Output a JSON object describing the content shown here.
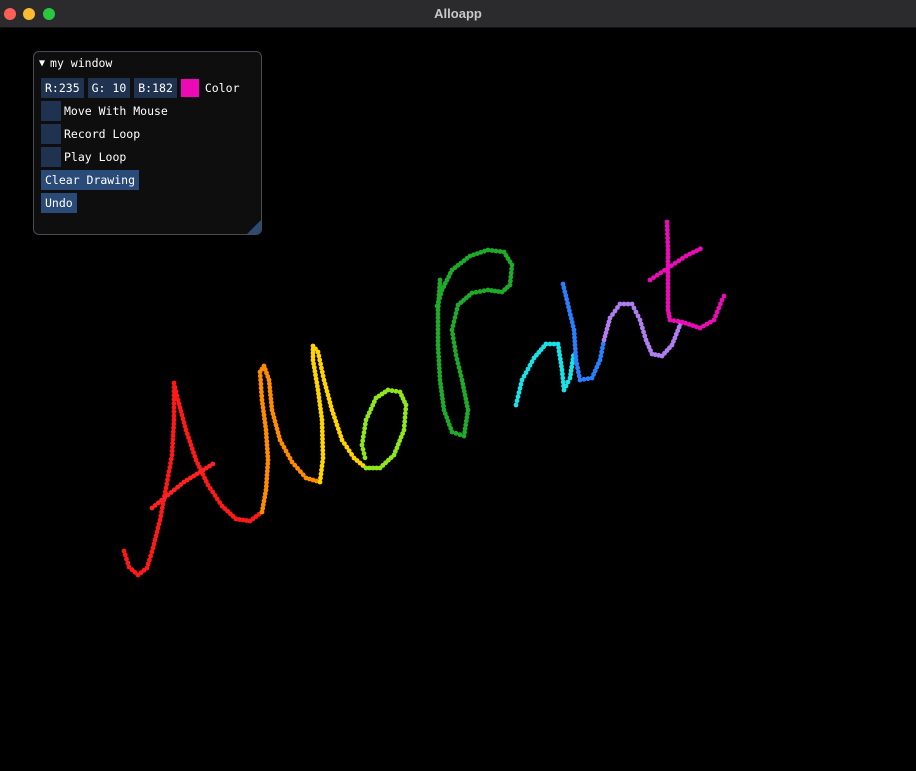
{
  "app": {
    "title": "Alloapp"
  },
  "panel": {
    "title": "my window",
    "color": {
      "r_label": "R:235",
      "g_label": "G: 10",
      "b_label": "B:182",
      "label": "Color",
      "swatch_hex": "#eb0ab6"
    },
    "checkboxes": [
      {
        "label": "Move With Mouse",
        "checked": false
      },
      {
        "label": "Record Loop",
        "checked": false
      },
      {
        "label": "Play Loop",
        "checked": false
      }
    ],
    "buttons": {
      "clear": "Clear Drawing",
      "undo": "Undo"
    }
  }
}
